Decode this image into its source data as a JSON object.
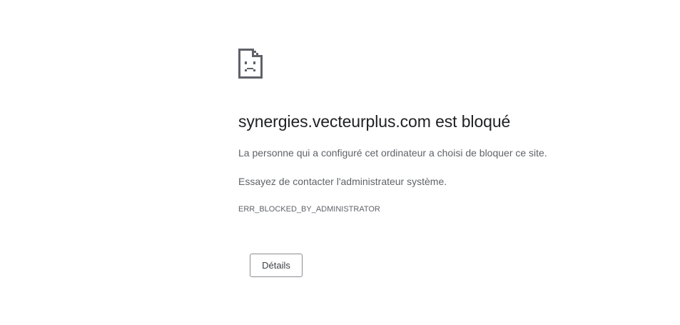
{
  "error": {
    "icon": "sad-document-icon",
    "title": "synergies.vecteurplus.com est bloqué",
    "message_primary": "La personne qui a configuré cet ordinateur a choisi de bloquer ce site.",
    "message_secondary": "Essayez de contacter l'administrateur système.",
    "code": "ERR_BLOCKED_BY_ADMINISTRATOR"
  },
  "actions": {
    "details_label": "Détails"
  },
  "colors": {
    "title": "#202124",
    "body_text": "#5f6368",
    "icon": "#5f6368",
    "button_border": "#8a8d91"
  }
}
